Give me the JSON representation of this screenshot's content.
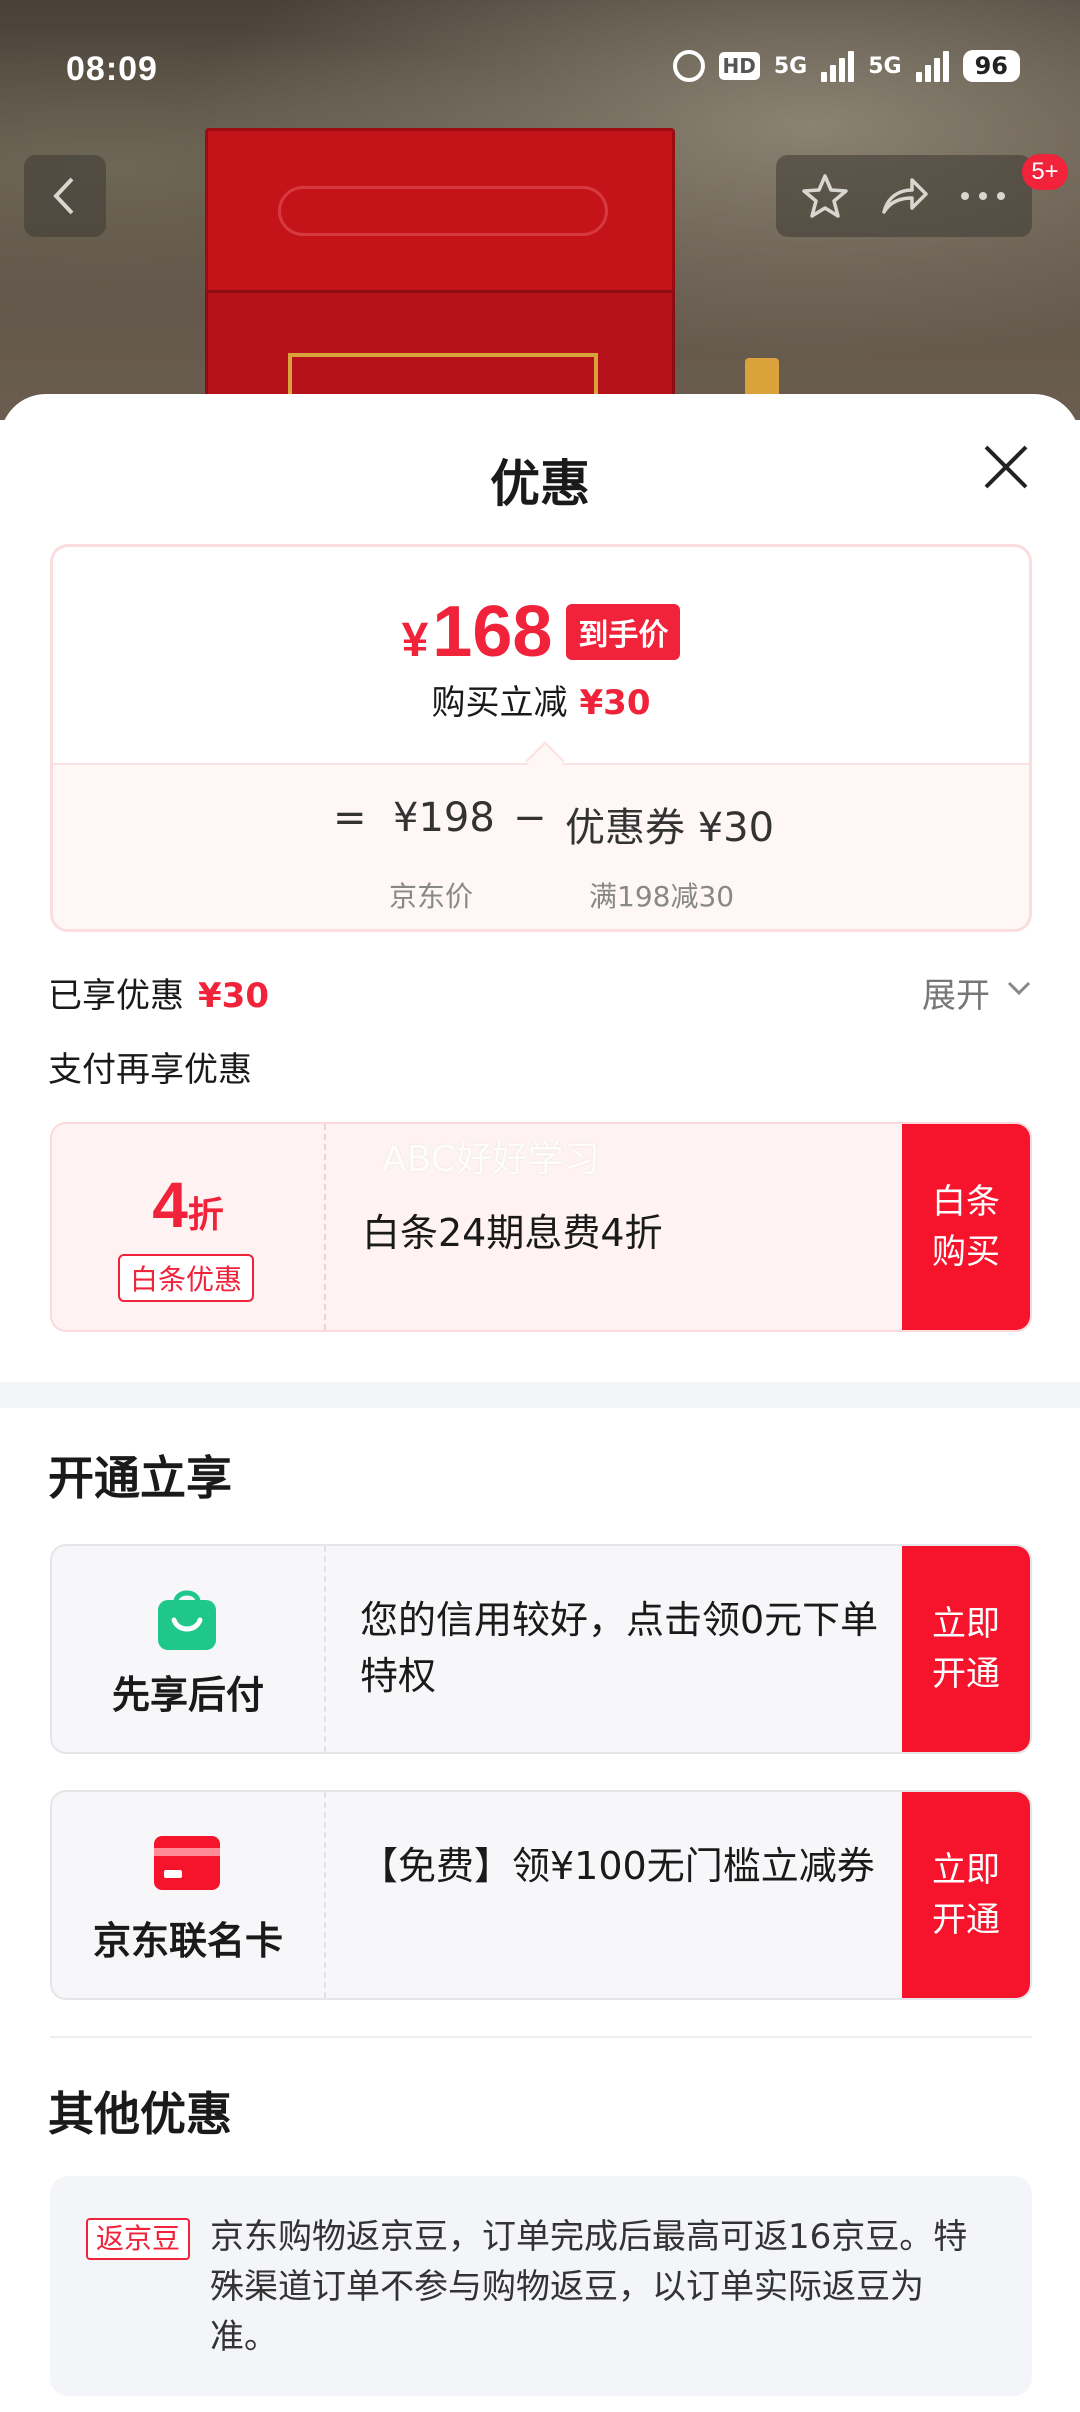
{
  "status_bar": {
    "time": "08:09",
    "hd": "HD",
    "net1": "5G",
    "net2": "5G",
    "battery": "96"
  },
  "nav": {
    "badge": "5+"
  },
  "sheet": {
    "title": "优惠"
  },
  "price_card": {
    "currency": "¥",
    "final_price": "168",
    "final_tag": "到手价",
    "reduce_label": "购买立减",
    "reduce_amount": "¥30",
    "eq": "=",
    "jd_price": "¥198",
    "minus": "−",
    "coupon": "优惠券 ¥30",
    "jd_price_label": "京东价",
    "coupon_label": "满198减30"
  },
  "enjoyed": {
    "label": "已享优惠",
    "amount": "¥30",
    "expand": "展开"
  },
  "pay_more": "支付再享优惠",
  "baitiao": {
    "discount": "4",
    "discount_unit": "折",
    "tag": "白条优惠",
    "watermark": "ABC好好学习",
    "text": "白条24期息费4折",
    "button": "白条\n购买"
  },
  "open_section": {
    "title": "开通立享"
  },
  "xianxiang": {
    "name": "先享后付",
    "text": "您的信用较好，点击领0元下单特权",
    "button": "立即\n开通",
    "icon": "shopping-bag-icon",
    "icon_color": "#1fc88a"
  },
  "cobrand": {
    "name": "京东联名卡",
    "text": "【免费】领¥100无门槛立减券",
    "button": "立即\n开通",
    "icon": "credit-card-icon",
    "icon_color": "#f5142b"
  },
  "other_section": {
    "title": "其他优惠"
  },
  "jingdou": {
    "tag": "返京豆",
    "text": "京东购物返京豆，订单完成后最高可返16京豆。特殊渠道订单不参与购物返豆，以订单实际返豆为准。"
  },
  "colors": {
    "accent": "#f0233a",
    "button": "#f5142b"
  }
}
